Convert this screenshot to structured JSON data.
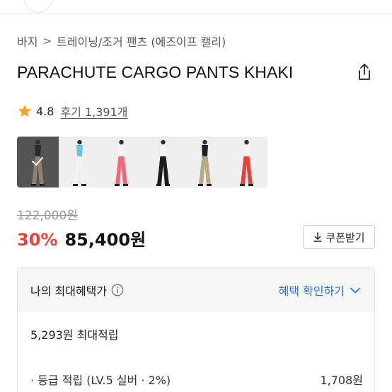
{
  "breadcrumb": {
    "root": "바지",
    "separator": ">",
    "current": "트레이닝/조거 팬츠 (에즈이프 캘리)"
  },
  "product": {
    "title": "PARACHUTE CARGO PANTS KHAKI"
  },
  "rating": {
    "score": "4.8",
    "reviews": "후기 1,391개",
    "star_color": "#f5a623"
  },
  "thumbnails": [
    {
      "name": "khaki-selected",
      "top_color": "#2a2a2a",
      "pants_color": "#8e836a",
      "selected": true
    },
    {
      "name": "white",
      "top_color": "#6cc7d8",
      "pants_color": "#f2f2f2",
      "selected": false
    },
    {
      "name": "pink",
      "top_color": "#f6f6f6",
      "pants_color": "#f0657a",
      "selected": false
    },
    {
      "name": "black",
      "top_color": "#f4f4f4",
      "pants_color": "#1c1c1c",
      "selected": false
    },
    {
      "name": "khaki",
      "top_color": "#1d1d1d",
      "pants_color": "#b8a888",
      "selected": false
    },
    {
      "name": "red",
      "top_color": "#f4f4f4",
      "pants_color": "#e5443b",
      "selected": false
    }
  ],
  "price": {
    "original": "122,000원",
    "discount": "30%",
    "sale": "85,400원",
    "discount_color": "#e8413c"
  },
  "coupon": {
    "label": "쿠폰받기",
    "icon": "download-icon"
  },
  "benefit": {
    "title": "나의 최대혜택가",
    "info_icon": "info-icon",
    "link": "혜택 확인하기",
    "link_color": "#2b6fd6",
    "max_points": "5,293원 최대적립",
    "grade_label": "· 등급 적립 (LV.5 실버 · 2%)",
    "grade_value": "1,708원"
  }
}
